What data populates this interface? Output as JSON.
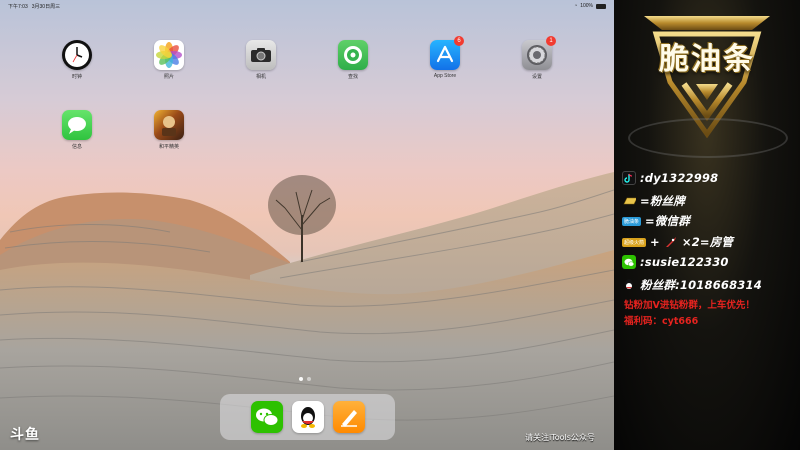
{
  "status_bar": {
    "time": "下午7:03",
    "date": "3月30日周三",
    "battery": "100%"
  },
  "home_apps": [
    {
      "name": "clock",
      "label": "时钟",
      "badge": ""
    },
    {
      "name": "photos",
      "label": "照片",
      "badge": ""
    },
    {
      "name": "camera",
      "label": "相机",
      "badge": ""
    },
    {
      "name": "find-my",
      "label": "查找",
      "badge": ""
    },
    {
      "name": "app-store",
      "label": "App Store",
      "badge": "6"
    },
    {
      "name": "settings",
      "label": "设置",
      "badge": "1"
    },
    {
      "name": "messages",
      "label": "信息",
      "badge": ""
    },
    {
      "name": "game",
      "label": "和平精英",
      "badge": ""
    }
  ],
  "dock_apps": [
    "wechat",
    "qq",
    "pages"
  ],
  "watermark": {
    "brand": "斗鱼",
    "note": "请关注iTools公众号"
  },
  "panel": {
    "logo_text": "脆油条",
    "douyin": ":dy1322998",
    "fan_badge": "=粉丝牌",
    "wechat_group_tag": "脆油条",
    "wechat_group": "=微信群",
    "room_admin_tag": "超级火箭",
    "room_admin": "×2=房管",
    "wechat_id": ":susie122330",
    "fan_group": "粉丝群:1018668314",
    "promo_line1": "钻粉加V进钻粉群，上车优先！",
    "promo_line2": "福利码：cyt666"
  },
  "colors": {
    "accent_red": "#e6231f",
    "gold": "#c9a443",
    "badge_red": "#f23b30"
  }
}
